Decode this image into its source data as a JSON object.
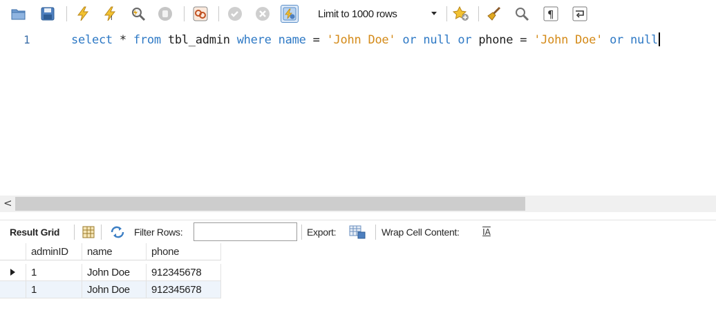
{
  "toolbar": {
    "buttons": [
      {
        "name": "open-folder-icon",
        "color": "#3d6fa8"
      },
      {
        "name": "save-icon",
        "color": "#3d6fa8"
      },
      {
        "name": "execute-lightning-icon",
        "color": "#e0a820"
      },
      {
        "name": "execute-current-lightning-icon",
        "color": "#e0a820"
      },
      {
        "name": "explain-magnifier-icon",
        "color": "#6a6a6a"
      },
      {
        "name": "stop-hand-icon",
        "color": "#9a9a9a"
      },
      {
        "name": "toggle-autocommit-icon",
        "color": "#c05020"
      },
      {
        "name": "commit-check-icon",
        "color": "#9a9a9a"
      },
      {
        "name": "rollback-x-icon",
        "color": "#9a9a9a"
      },
      {
        "name": "stop-on-error-icon",
        "color": "#5b8fc9"
      }
    ],
    "limit_label": "Limit to 1000 rows",
    "right_buttons": [
      "add-snippet-star-icon",
      "beautify-broom-icon",
      "find-magnifier-icon",
      "invisible-chars-pilcrow-icon",
      "wrap-lines-icon"
    ]
  },
  "editor": {
    "line_number": "1",
    "tokens": [
      {
        "t": "select",
        "k": "kw"
      },
      {
        "t": " * ",
        "k": "plain"
      },
      {
        "t": "from",
        "k": "kw"
      },
      {
        "t": " tbl_admin ",
        "k": "plain"
      },
      {
        "t": "where",
        "k": "kw"
      },
      {
        "t": " ",
        "k": "plain"
      },
      {
        "t": "name",
        "k": "kw"
      },
      {
        "t": " = ",
        "k": "plain"
      },
      {
        "t": "'John Doe'",
        "k": "str"
      },
      {
        "t": " ",
        "k": "plain"
      },
      {
        "t": "or",
        "k": "kw"
      },
      {
        "t": " ",
        "k": "plain"
      },
      {
        "t": "null",
        "k": "kw"
      },
      {
        "t": " ",
        "k": "plain"
      },
      {
        "t": "or",
        "k": "kw"
      },
      {
        "t": " phone = ",
        "k": "plain"
      },
      {
        "t": "'John Doe'",
        "k": "str"
      },
      {
        "t": " ",
        "k": "plain"
      },
      {
        "t": "or",
        "k": "kw"
      },
      {
        "t": " ",
        "k": "plain"
      },
      {
        "t": "null",
        "k": "kw"
      }
    ]
  },
  "scrollbar": {
    "left_arrow": "<"
  },
  "result_bar": {
    "result_grid_label": "Result Grid",
    "filter_rows_label": "Filter Rows:",
    "filter_value": "",
    "export_label": "Export:",
    "wrap_label": "Wrap Cell Content:",
    "wrap_icon_text": "IA"
  },
  "grid": {
    "columns": [
      "adminID",
      "name",
      "phone"
    ],
    "rows": [
      [
        "1",
        "John Doe",
        "912345678"
      ],
      [
        "1",
        "John Doe",
        "912345678"
      ]
    ]
  },
  "colors": {
    "keyword": "#2e79c5",
    "string": "#d48a18",
    "alt_row": "#eef4fb"
  }
}
